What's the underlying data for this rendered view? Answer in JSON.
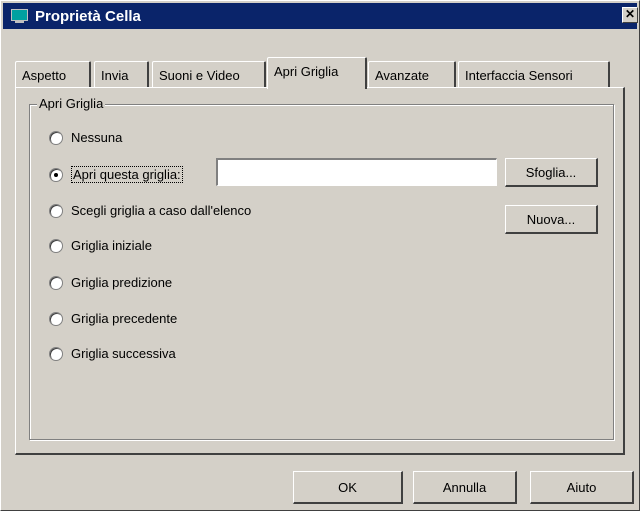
{
  "window": {
    "title": "Proprietà Cella",
    "close_glyph": "✕"
  },
  "tabs": [
    {
      "label": "Aspetto"
    },
    {
      "label": "Invia"
    },
    {
      "label": "Suoni e Video"
    },
    {
      "label": "Apri Griglia",
      "active": true
    },
    {
      "label": "Avanzate"
    },
    {
      "label": "Interfaccia Sensori"
    }
  ],
  "group": {
    "label": "Apri Griglia",
    "options": [
      {
        "label": "Nessuna",
        "checked": false
      },
      {
        "label": "Apri questa griglia:",
        "checked": true
      },
      {
        "label": "Scegli griglia a caso dall'elenco",
        "checked": false
      },
      {
        "label": "Griglia iniziale",
        "checked": false
      },
      {
        "label": "Griglia predizione",
        "checked": false
      },
      {
        "label": "Griglia precedente",
        "checked": false
      },
      {
        "label": "Griglia successiva",
        "checked": false
      }
    ],
    "grid_path_value": "",
    "browse_label": "Sfoglia...",
    "new_label": "Nuova..."
  },
  "footer": {
    "ok_label": "OK",
    "cancel_label": "Annulla",
    "help_label": "Aiuto"
  },
  "colors": {
    "titlebar": "#0a246a",
    "face": "#d4d0c8"
  },
  "icons": {
    "app": "computer-screen-icon",
    "close": "close-icon"
  }
}
